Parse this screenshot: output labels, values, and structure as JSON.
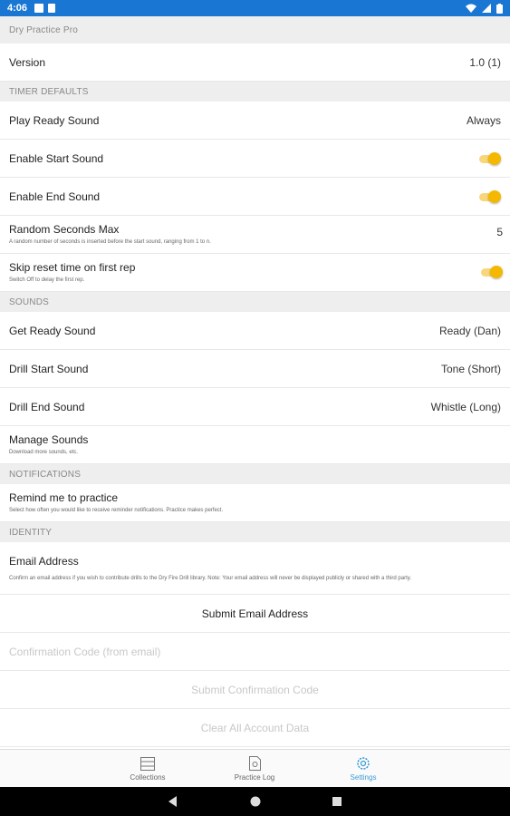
{
  "status_bar": {
    "time": "4:06"
  },
  "app_title": "Dry Practice Pro",
  "version": {
    "label": "Version",
    "value": "1.0 (1)"
  },
  "timer_defaults": {
    "header": "TIMER DEFAULTS",
    "play_ready_sound": {
      "label": "Play Ready Sound",
      "value": "Always"
    },
    "enable_start_sound": {
      "label": "Enable Start Sound",
      "on": true
    },
    "enable_end_sound": {
      "label": "Enable End Sound",
      "on": true
    },
    "random_seconds_max": {
      "label": "Random Seconds Max",
      "value": "5",
      "description": "A random number of seconds is inserted before the start sound, ranging from 1 to n."
    },
    "skip_reset": {
      "label": "Skip reset time on first rep",
      "description": "Switch Off to delay the first rep.",
      "on": true
    }
  },
  "sounds": {
    "header": "SOUNDS",
    "get_ready": {
      "label": "Get Ready Sound",
      "value": "Ready (Dan)"
    },
    "drill_start": {
      "label": "Drill Start Sound",
      "value": "Tone (Short)"
    },
    "drill_end": {
      "label": "Drill End Sound",
      "value": "Whistle (Long)"
    },
    "manage": {
      "label": "Manage Sounds",
      "description": "Download more sounds, etc."
    }
  },
  "notifications": {
    "header": "NOTIFICATIONS",
    "remind": {
      "label": "Remind me to practice",
      "description": "Select how often you would like to receive reminder notifications. Practice makes perfect."
    }
  },
  "identity": {
    "header": "IDENTITY",
    "email": {
      "label": "Email Address",
      "description": "Confirm an email address if you wish to contribute drills to the Dry Fire Drill library. Note: Your email address will never be displayed publicly or shared with a third party."
    },
    "submit_email": "Submit Email Address",
    "confirmation_placeholder": "Confirmation Code (from email)",
    "submit_confirmation": "Submit Confirmation Code",
    "clear_data": "Clear All Account Data"
  },
  "tabs": [
    {
      "label": "Collections",
      "icon": "collections-icon"
    },
    {
      "label": "Practice Log",
      "icon": "practice-log-icon"
    },
    {
      "label": "Settings",
      "icon": "settings-icon",
      "active": true
    }
  ],
  "colors": {
    "status_bar": "#1976d2",
    "toggle_on": "#f5b800",
    "active_tab": "#3a9bd5"
  }
}
